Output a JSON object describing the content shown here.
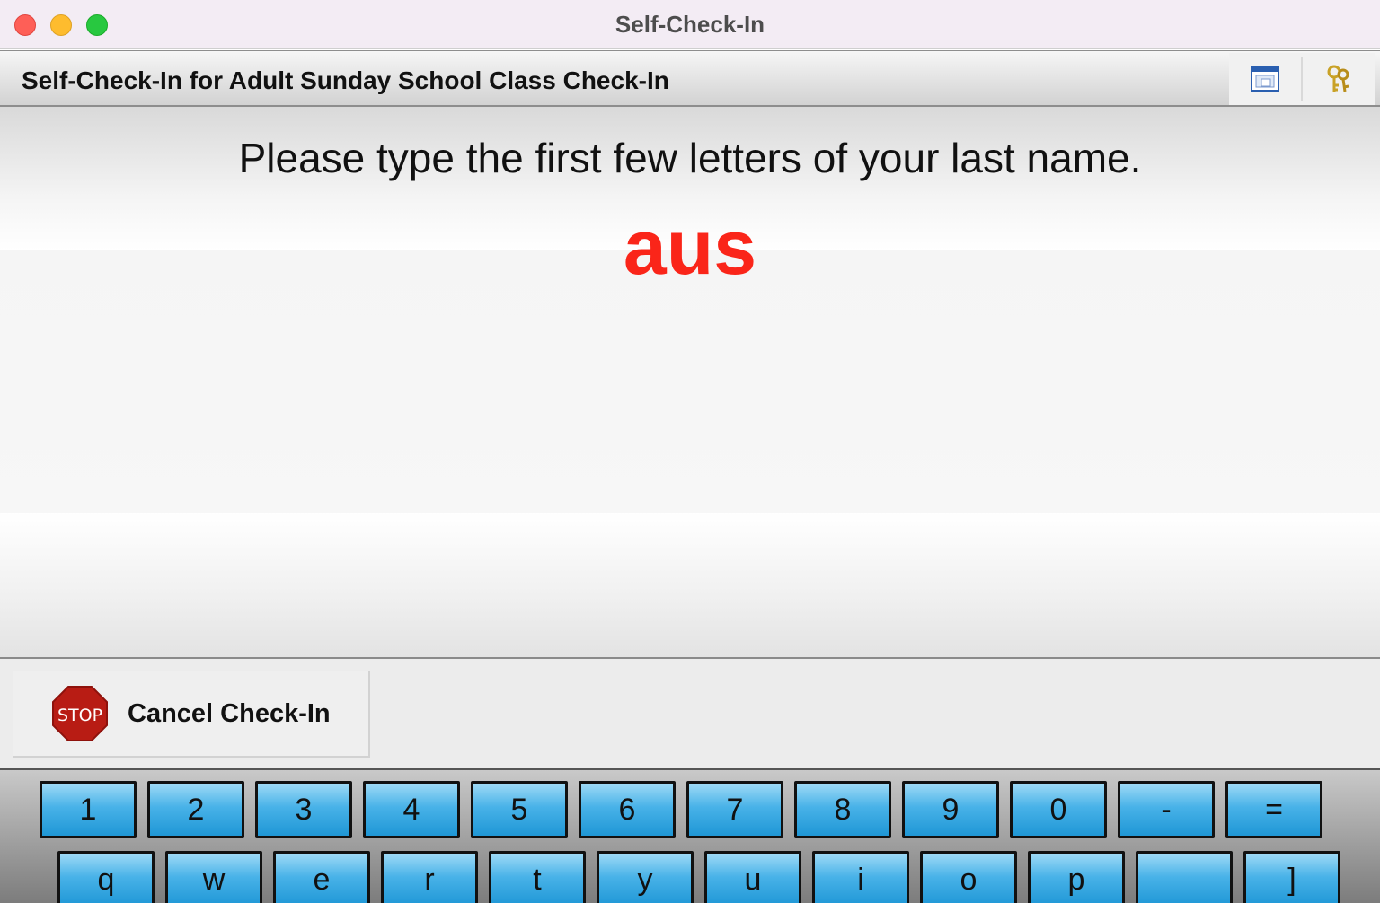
{
  "window": {
    "title": "Self-Check-In"
  },
  "header": {
    "title": "Self-Check-In for Adult Sunday School Class Check-In",
    "tools": [
      "screen-icon",
      "keys-icon"
    ]
  },
  "main": {
    "prompt": "Please type the first few letters of your last name.",
    "typed_text": "aus",
    "typed_color": "#fa2519"
  },
  "actions": {
    "cancel_label": "Cancel Check-In",
    "cancel_icon": "stop-sign-icon",
    "stop_text": "STOP"
  },
  "keyboard": {
    "key_color": "#3aa8e2",
    "row1": [
      "1",
      "2",
      "3",
      "4",
      "5",
      "6",
      "7",
      "8",
      "9",
      "0",
      "-",
      "="
    ],
    "row2": [
      "q",
      "w",
      "e",
      "r",
      "t",
      "y",
      "u",
      "i",
      "o",
      "p",
      "",
      "]"
    ]
  }
}
